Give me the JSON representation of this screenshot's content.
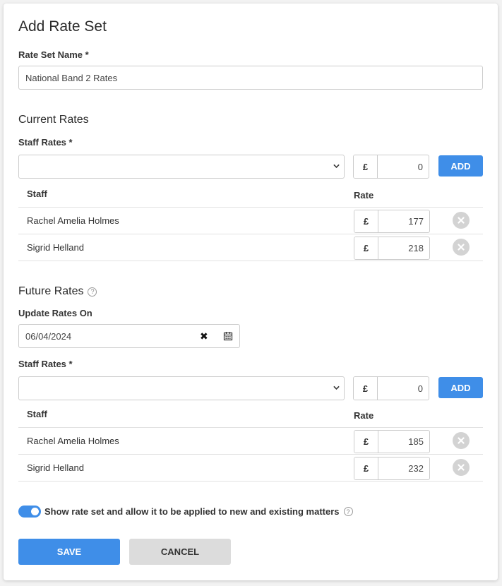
{
  "title": "Add Rate Set",
  "rate_set_name": {
    "label": "Rate Set Name *",
    "value": "National Band 2 Rates"
  },
  "current": {
    "heading": "Current Rates",
    "staff_rates_label": "Staff Rates *",
    "select_value": "",
    "currency": "£",
    "rate_value": "0",
    "add_label": "ADD",
    "col_staff": "Staff",
    "col_rate": "Rate",
    "rows": [
      {
        "name": "Rachel Amelia Holmes",
        "currency": "£",
        "rate": "177"
      },
      {
        "name": "Sigrid Helland",
        "currency": "£",
        "rate": "218"
      }
    ]
  },
  "future": {
    "heading": "Future Rates",
    "update_label": "Update Rates On",
    "date_value": "06/04/2024",
    "staff_rates_label": "Staff Rates *",
    "select_value": "",
    "currency": "£",
    "rate_value": "0",
    "add_label": "ADD",
    "col_staff": "Staff",
    "col_rate": "Rate",
    "rows": [
      {
        "name": "Rachel Amelia Holmes",
        "currency": "£",
        "rate": "185"
      },
      {
        "name": "Sigrid Helland",
        "currency": "£",
        "rate": "232"
      }
    ]
  },
  "toggle": {
    "label": "Show rate set and allow it to be applied to new and existing matters",
    "on": true
  },
  "help_glyph": "?",
  "clear_glyph": "✖",
  "buttons": {
    "save": "SAVE",
    "cancel": "CANCEL"
  },
  "colors": {
    "accent": "#3f8ee8",
    "remove": "#d3d3d3",
    "cancel_bg": "#dcdcdc"
  }
}
